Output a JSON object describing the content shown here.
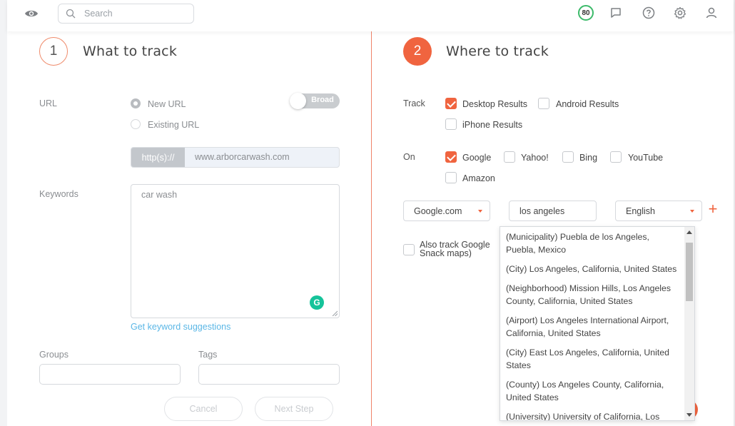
{
  "header": {
    "search_placeholder": "Search",
    "score": "80",
    "icons": [
      "eye-icon",
      "search-icon",
      "feedback-icon",
      "help-icon",
      "settings-icon",
      "user-icon"
    ]
  },
  "step1": {
    "number": "1",
    "title": "What to track",
    "url_label": "URL",
    "radio_new": "New URL",
    "radio_existing": "Existing URL",
    "selected": "New URL",
    "toggle_label": "Broad",
    "url_prefix": "http(s)://",
    "url_value": "www.arborcarwash.com",
    "keywords_label": "Keywords",
    "keywords_value": "car wash",
    "suggestions_link": "Get keyword suggestions",
    "groups_label": "Groups",
    "tags_label": "Tags",
    "cancel_button": "Cancel",
    "next_button": "Next Step"
  },
  "step2": {
    "number": "2",
    "title": "Where to track",
    "track_label": "Track",
    "track_options": [
      {
        "label": "Desktop Results",
        "checked": true
      },
      {
        "label": "Android Results",
        "checked": false
      },
      {
        "label": "iPhone Results",
        "checked": false
      }
    ],
    "on_label": "On",
    "engines": [
      {
        "label": "Google",
        "checked": true
      },
      {
        "label": "Yahoo!",
        "checked": false
      },
      {
        "label": "Bing",
        "checked": false
      },
      {
        "label": "YouTube",
        "checked": false
      },
      {
        "label": "Amazon",
        "checked": false
      }
    ],
    "domain_select": "Google.com",
    "location_value": "los angeles",
    "language_select": "English",
    "also_track": "Also track Google Snack maps)",
    "location_suggestions": [
      "(Municipality) Puebla de los Angeles, Puebla, Mexico",
      "(City) Los Angeles, California, United States",
      "(Neighborhood) Mission Hills, Los Angeles County, California, United States",
      "(Airport) Los Angeles International Airport, California, United States",
      "(City) East Los Angeles, California, United States",
      "(County) Los Angeles County, California, United States",
      "(University) University of California, Los Angeles"
    ]
  },
  "colors": {
    "accent": "#f0643f",
    "score_ring": "#3cba6a",
    "link": "#5bb7e6"
  }
}
